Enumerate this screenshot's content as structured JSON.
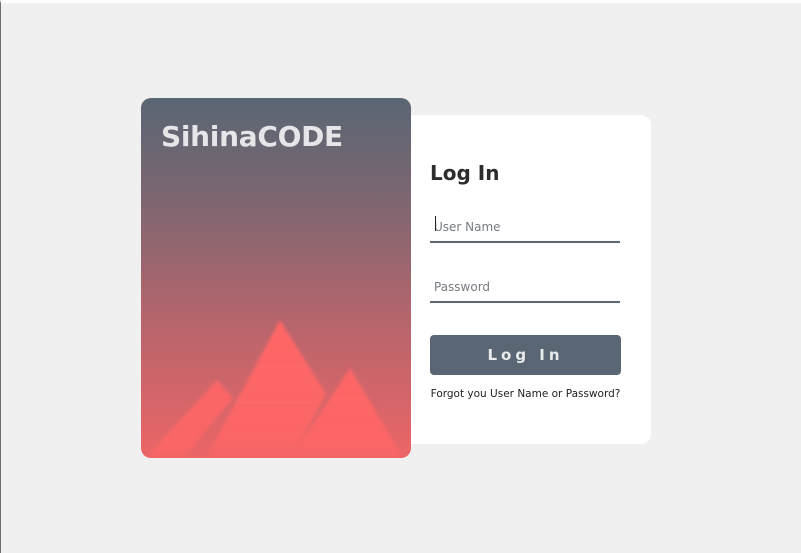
{
  "brand": {
    "name": "SihinaCODE"
  },
  "login_form": {
    "title": "Log In",
    "username": {
      "value": "",
      "placeholder": "User Name"
    },
    "password": {
      "value": "",
      "placeholder": "Password"
    },
    "submit_label": "Log In",
    "forgot_link": "Forgot you User Name or Password?"
  },
  "colors": {
    "page_background": "#f0f0f0",
    "card_background": "#ffffff",
    "gradient_top": "#5a6674",
    "gradient_bottom": "#ec6567",
    "mountain": "#ff6666",
    "button": "#5a6673",
    "input_underline": "#5b6876"
  },
  "icons": {
    "brand_illustration": "mountains-icon"
  }
}
